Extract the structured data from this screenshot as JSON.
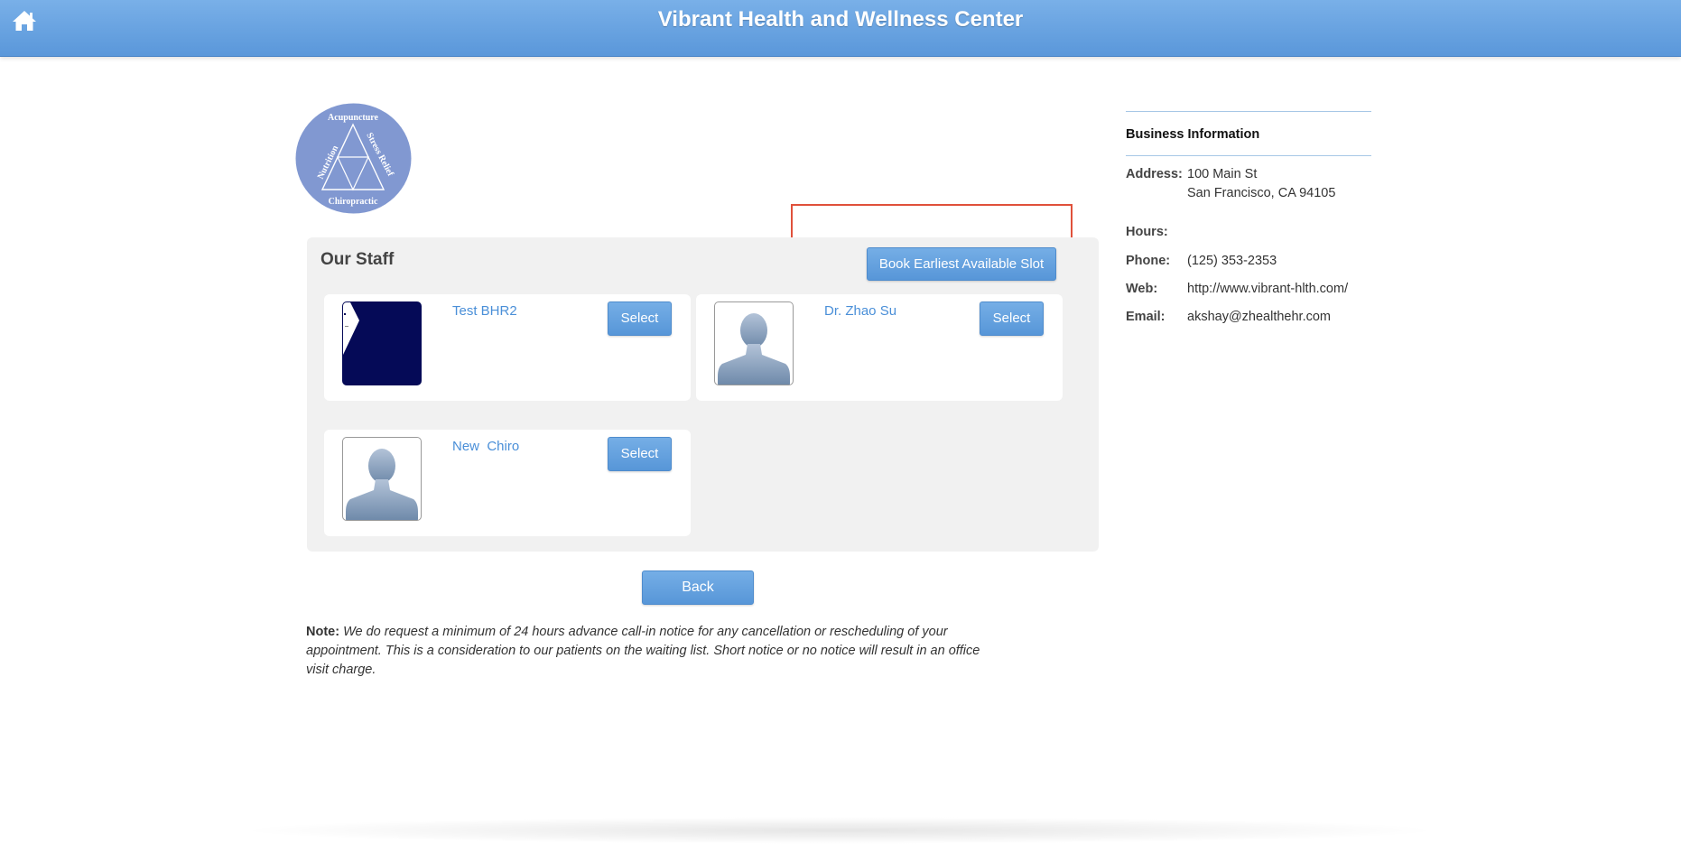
{
  "header": {
    "title": "Vibrant Health and Wellness Center",
    "home_icon": "home-icon"
  },
  "logo": {
    "top": "Acupuncture",
    "left": "Nutrition",
    "right": "Stress Relief",
    "bottom": "Chiropractic",
    "color": "#8198d1"
  },
  "staff": {
    "heading": "Our Staff",
    "book_label": "Book Earliest Available Slot",
    "members": [
      {
        "name": "Test BHR2",
        "select_label": "Select",
        "photo": "custom-image"
      },
      {
        "name": "Dr. Zhao Su",
        "select_label": "Select",
        "photo": "silhouette-icon"
      },
      {
        "name": "New  Chiro",
        "select_label": "Select",
        "photo": "silhouette-icon"
      }
    ]
  },
  "back_label": "Back",
  "note": {
    "label": "Note:",
    "text": "We do request a minimum of 24 hours advance call-in notice for any cancellation or rescheduling of your appointment. This is a consideration to our patients on the waiting list. Short notice or no notice will result in an office visit charge."
  },
  "business": {
    "title": "Business Information",
    "address_label": "Address:",
    "address_line1": "100 Main St",
    "address_line2": "San Francisco, CA 94105",
    "hours_label": "Hours:",
    "phone_label": "Phone:",
    "phone": "(125) 353-2353",
    "web_label": "Web:",
    "web": "http://www.vibrant-hlth.com/",
    "email_label": "Email:",
    "email": "akshay@zhealthehr.com"
  },
  "colors": {
    "header": "#5a97da",
    "button": "#5796d8",
    "highlight": "#e0513b"
  }
}
